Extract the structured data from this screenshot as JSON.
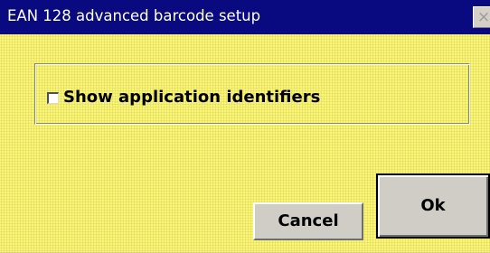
{
  "window": {
    "title": "EAN 128 advanced barcode setup",
    "close_glyph": "×"
  },
  "options": {
    "show_application_identifiers": {
      "label": "Show application identifiers",
      "checked": false
    }
  },
  "buttons": {
    "cancel_label": "Cancel",
    "ok_label": "Ok"
  },
  "colors": {
    "title_bar": "#0a0a80",
    "dialog_background": "#f8f57a",
    "button_face": "#cfcdc6"
  },
  "icons": {
    "close": "close-icon"
  }
}
